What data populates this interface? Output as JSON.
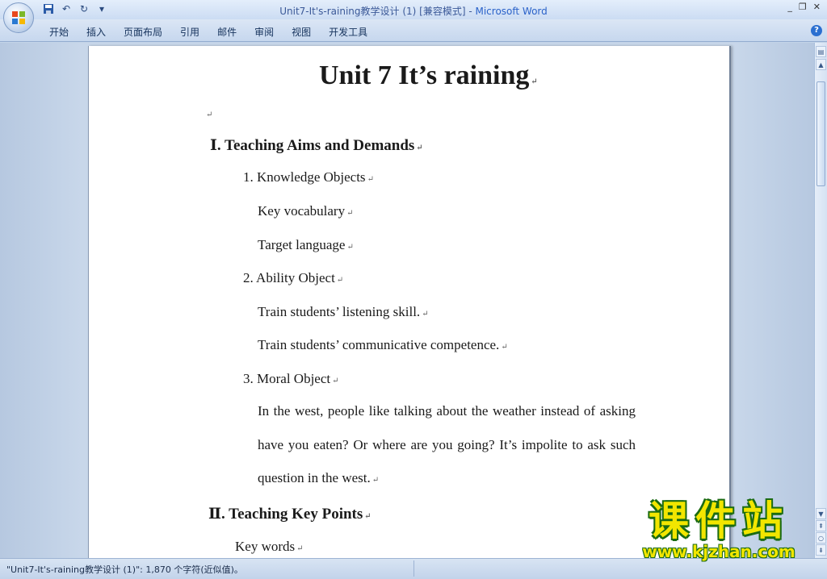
{
  "window": {
    "title_doc": "Unit7-It's-raining教学设计 (1) [兼容模式]",
    "title_sep": " - ",
    "title_app": "Microsoft Word",
    "controls": [
      "_",
      "❐",
      "✕"
    ]
  },
  "qat": {
    "save_icon": "save-icon",
    "undo_icon": "undo-icon",
    "redo_icon": "redo-icon",
    "customize": "▾"
  },
  "ribbon": {
    "tabs": [
      "开始",
      "插入",
      "页面布局",
      "引用",
      "邮件",
      "审阅",
      "视图",
      "开发工具"
    ],
    "help": "?"
  },
  "document": {
    "para_mark": "↵",
    "title": "Unit 7 It’s raining",
    "section1": "Ⅰ. Teaching Aims and Demands",
    "item1": "1. Knowledge Objects",
    "key_vocab": "Key vocabulary",
    "target_lang": "Target language",
    "item2": "2. Ability Object",
    "train1": "Train students’ listening skill.",
    "train2": "Train students’ communicative competence.",
    "item3": "3. Moral Object",
    "moral_text": "In the west, people like talking about the weather instead of asking have you eaten? Or where are you going? It’s impolite to ask such question in the west.",
    "section2": "Ⅱ. Teaching Key Points",
    "key_words": "Key words"
  },
  "statusbar": {
    "text": "\"Unit7-It's-raining教学设计 (1)\": 1,870 个字符(近似值)。"
  },
  "watermark": {
    "cn": "课件站",
    "url": "www.kjzhan.com"
  },
  "colors": {
    "title_app": "#2a62c9",
    "watermark_fill": "#f2e600",
    "watermark_stroke": "#1b6b12"
  }
}
